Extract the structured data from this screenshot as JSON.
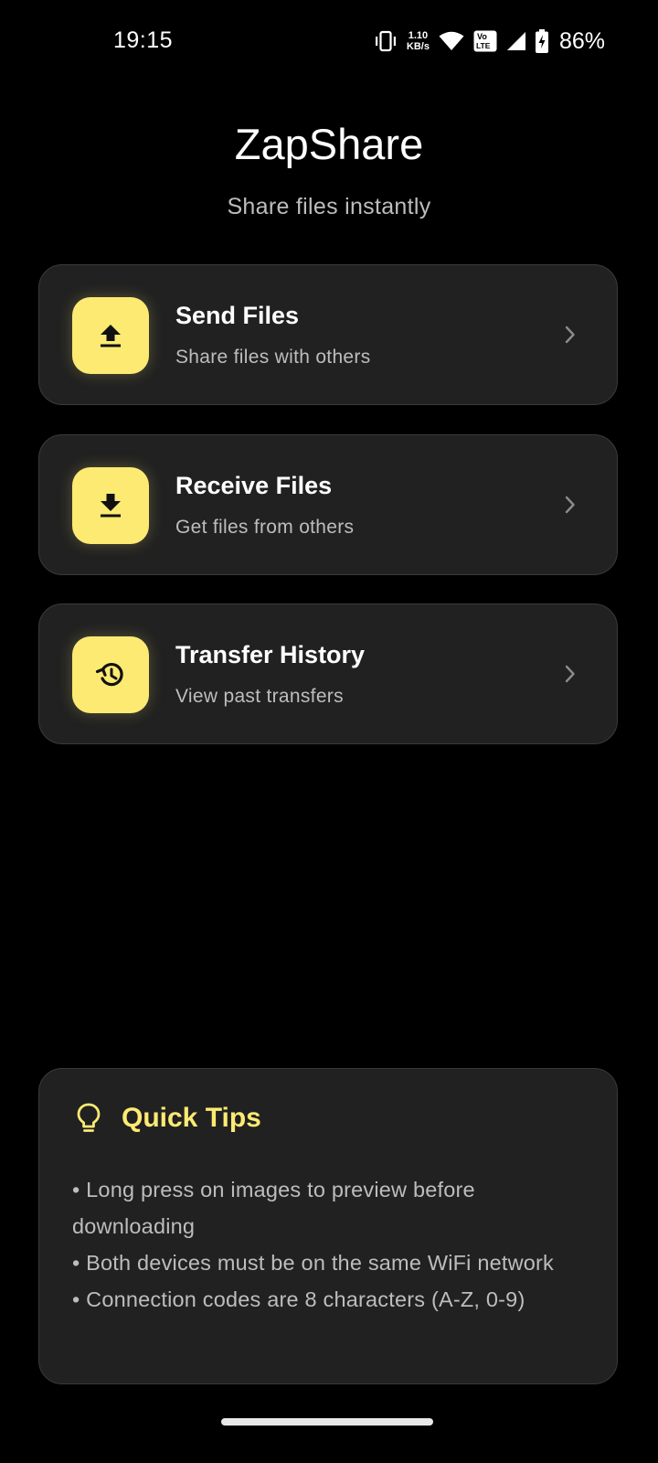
{
  "status_bar": {
    "time": "19:15",
    "net_speed_value": "1.10",
    "net_speed_unit": "KB/s",
    "battery_percent": "86%",
    "icons": [
      "vibrate-icon",
      "wifi-icon",
      "volte-icon",
      "signal-icon",
      "battery-charging-icon"
    ]
  },
  "header": {
    "title": "ZapShare",
    "subtitle": "Share files instantly"
  },
  "actions": [
    {
      "title": "Send Files",
      "description": "Share files with others",
      "icon": "upload-icon"
    },
    {
      "title": "Receive Files",
      "description": "Get files from others",
      "icon": "download-icon"
    },
    {
      "title": "Transfer History",
      "description": "View past transfers",
      "icon": "history-icon"
    }
  ],
  "tips": {
    "title": "Quick Tips",
    "icon": "lightbulb-icon",
    "items": [
      "• Long press on images to preview before downloading",
      "• Both devices must be on the same WiFi network",
      "• Connection codes are 8 characters (A-Z, 0-9)"
    ]
  },
  "colors": {
    "background": "#000000",
    "card_background": "#212121",
    "card_border": "#3a3a3a",
    "accent_yellow": "#fdea73",
    "secondary_text": "#bdbdbd"
  }
}
